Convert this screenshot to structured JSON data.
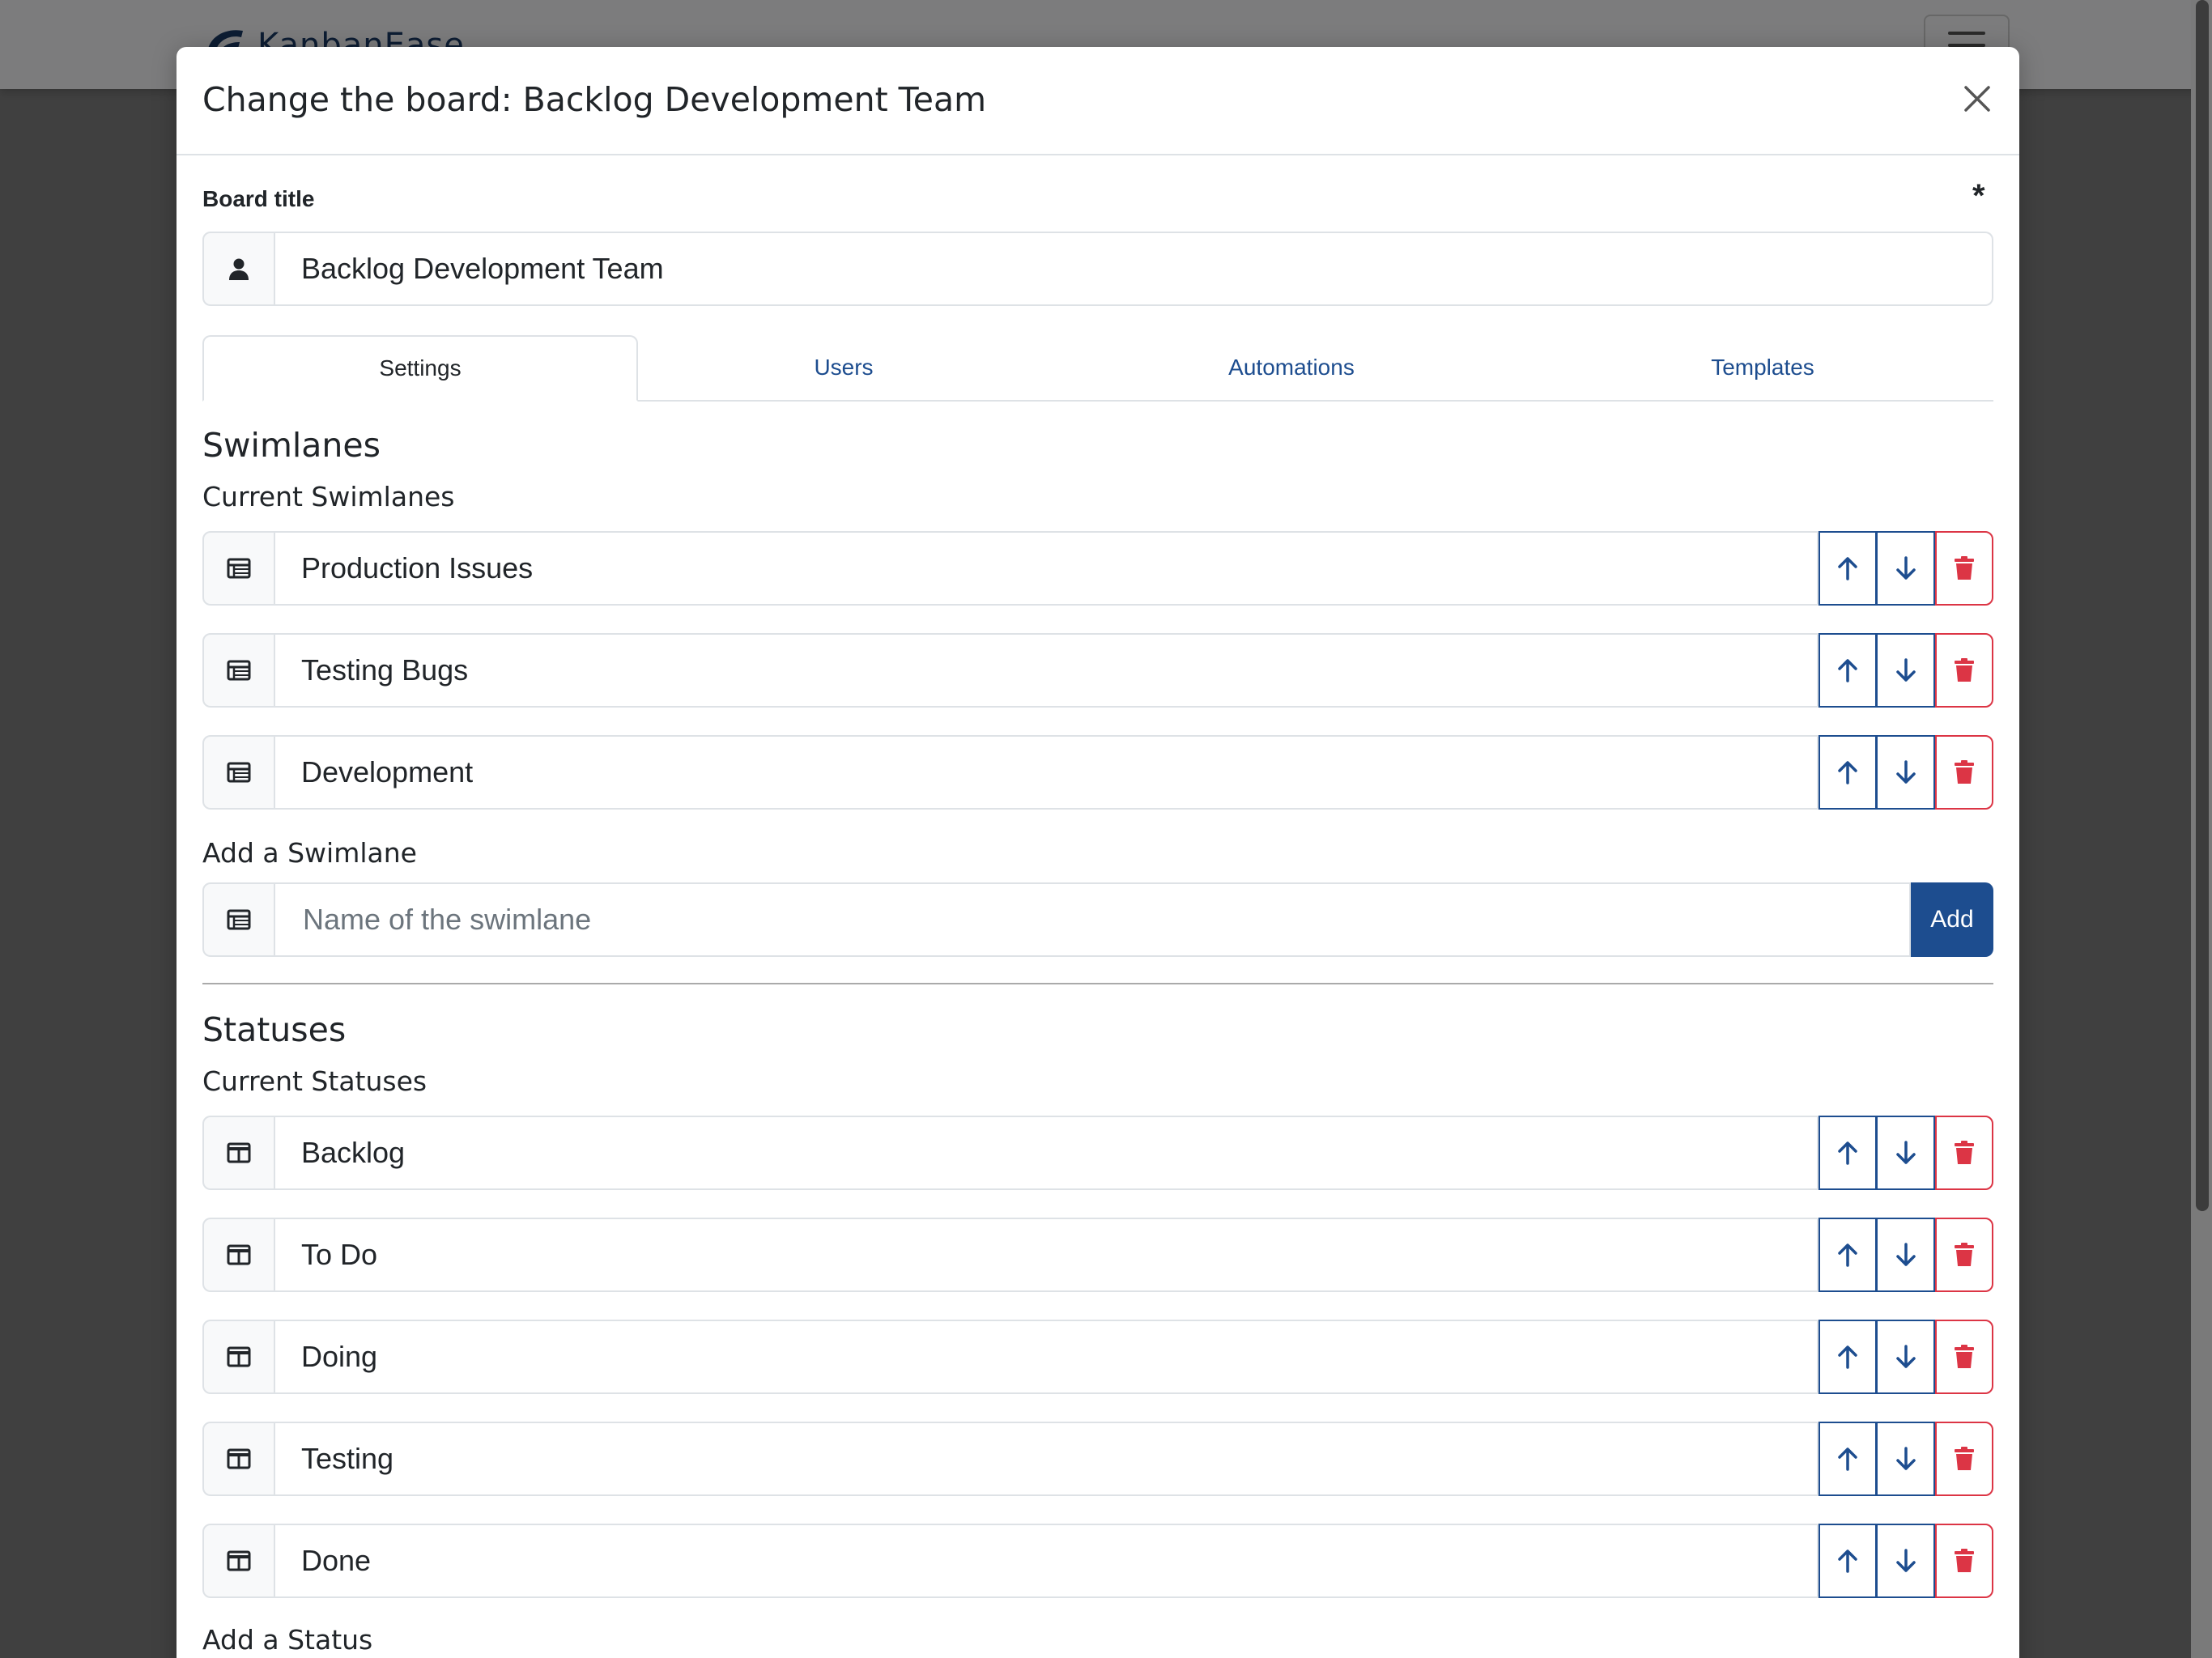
{
  "background": {
    "logo_text": "KanbanEase"
  },
  "modal": {
    "title": "Change the board: Backlog Development Team",
    "board_title_label": "Board title",
    "required_marker": "*",
    "board_title_value": "Backlog Development Team"
  },
  "tabs": [
    {
      "label": "Settings",
      "active": true
    },
    {
      "label": "Users",
      "active": false
    },
    {
      "label": "Automations",
      "active": false
    },
    {
      "label": "Templates",
      "active": false
    }
  ],
  "swimlanes": {
    "heading": "Swimlanes",
    "current_heading": "Current Swimlanes",
    "items": [
      "Production Issues",
      "Testing Bugs",
      "Development"
    ],
    "add_heading": "Add a Swimlane",
    "add_placeholder": "Name of the swimlane",
    "add_button": "Add"
  },
  "statuses": {
    "heading": "Statuses",
    "current_heading": "Current Statuses",
    "items": [
      "Backlog",
      "To Do",
      "Doing",
      "Testing",
      "Done"
    ],
    "add_heading": "Add a Status"
  },
  "colors": {
    "primary": "#1d4d8f",
    "danger": "#dc3545",
    "border": "#dee2e6"
  },
  "icons": {
    "board_title": "person-icon",
    "swimlane": "table-list-icon",
    "status": "columns-icon",
    "move_up": "arrow-up-icon",
    "move_down": "arrow-down-icon",
    "delete": "trash-icon",
    "close": "close-icon"
  }
}
